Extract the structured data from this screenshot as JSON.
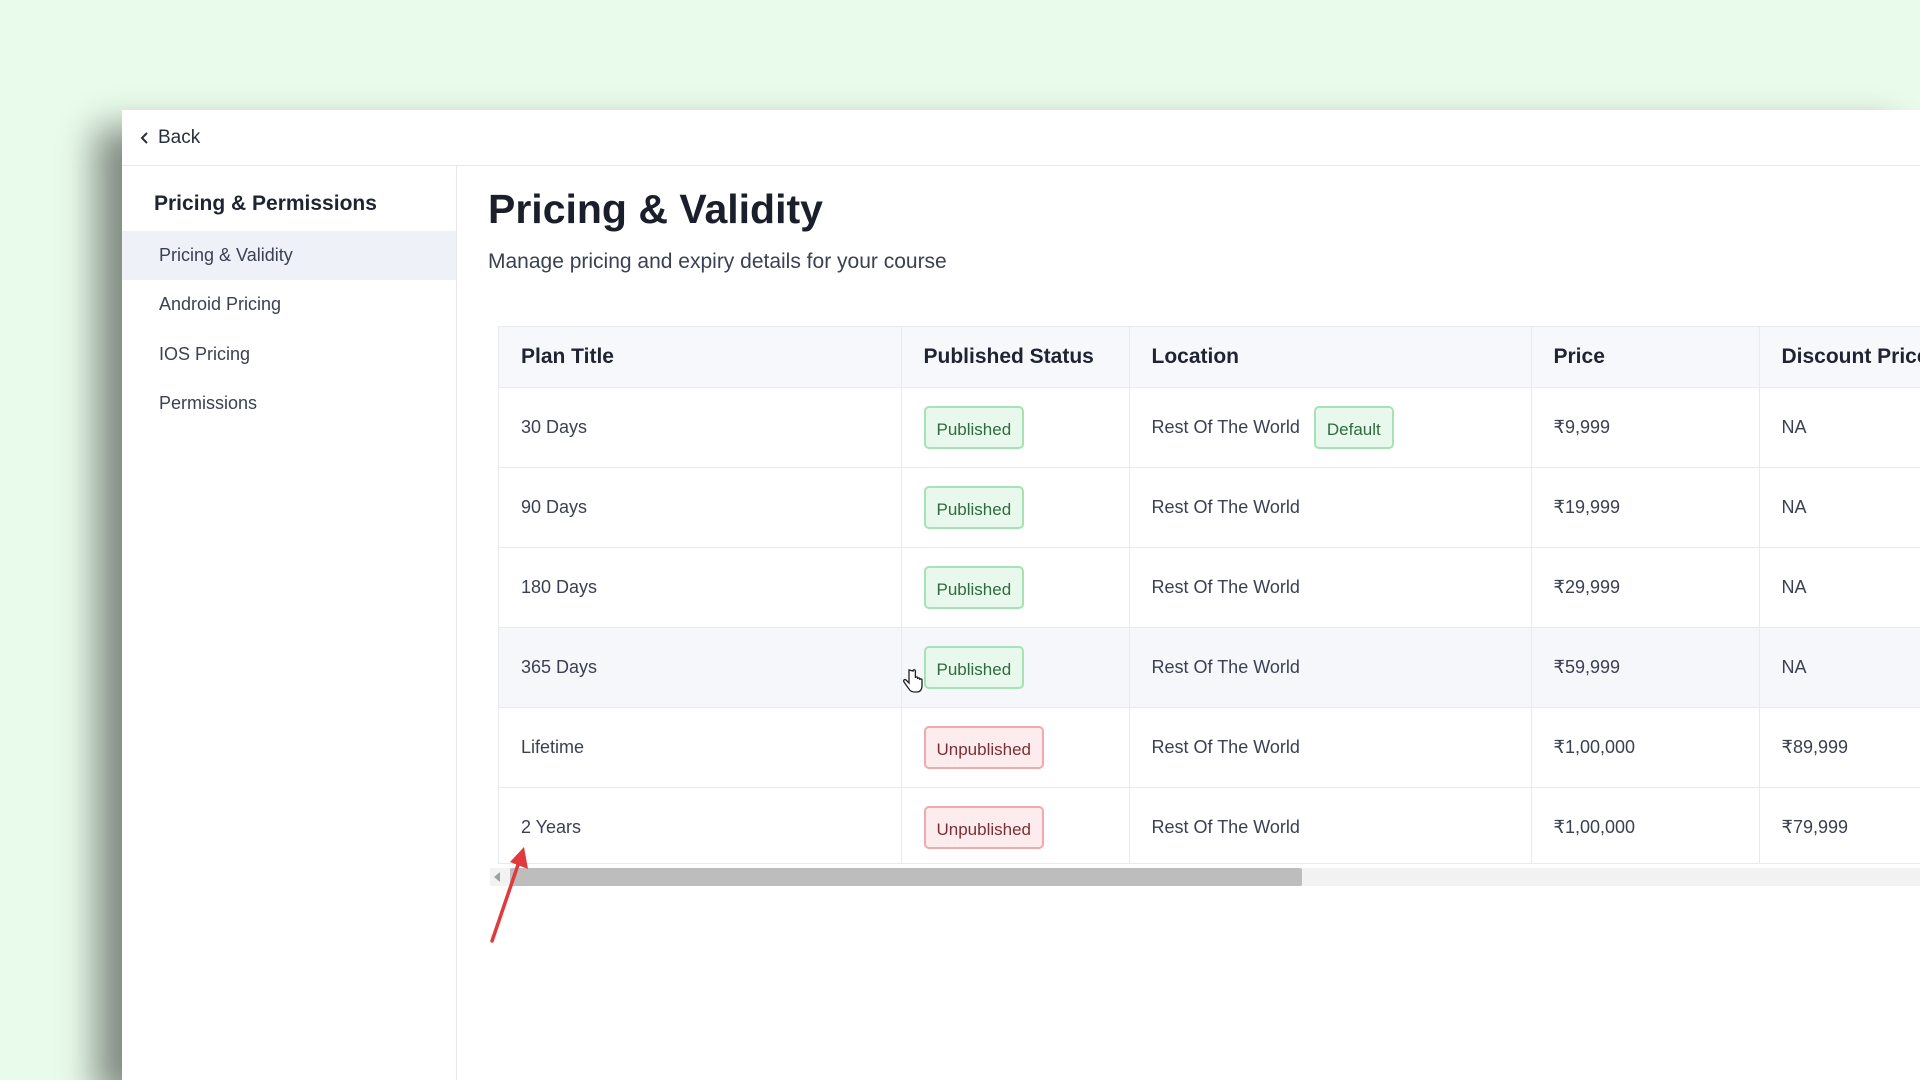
{
  "topbar": {
    "back_label": "Back"
  },
  "sidebar": {
    "title": "Pricing & Permissions",
    "items": [
      {
        "label": "Pricing & Validity",
        "active": true
      },
      {
        "label": "Android Pricing",
        "active": false
      },
      {
        "label": "IOS Pricing",
        "active": false
      },
      {
        "label": "Permissions",
        "active": false
      }
    ]
  },
  "main": {
    "title": "Pricing & Validity",
    "subtitle": "Manage pricing and expiry details for your course"
  },
  "table": {
    "columns": [
      "Plan Title",
      "Published Status",
      "Location",
      "Price",
      "Discount Price"
    ],
    "rows": [
      {
        "plan": "30 Days",
        "status": "Published",
        "location": "Rest Of The World",
        "default": "Default",
        "price": "₹9,999",
        "discount": "NA"
      },
      {
        "plan": "90 Days",
        "status": "Published",
        "location": "Rest Of The World",
        "price": "₹19,999",
        "discount": "NA"
      },
      {
        "plan": "180 Days",
        "status": "Published",
        "location": "Rest Of The World",
        "price": "₹29,999",
        "discount": "NA"
      },
      {
        "plan": "365 Days",
        "status": "Published",
        "location": "Rest Of The World",
        "price": "₹59,999",
        "discount": "NA"
      },
      {
        "plan": "Lifetime",
        "status": "Unpublished",
        "location": "Rest Of The World",
        "price": "₹1,00,000",
        "discount": "₹89,999"
      },
      {
        "plan": "2 Years",
        "status": "Unpublished",
        "location": "Rest Of The World",
        "price": "₹1,00,000",
        "discount": "₹79,999"
      }
    ]
  },
  "colors": {
    "background": "#e9fbea",
    "published_bg": "#e8f8ec",
    "published_border": "#a6e3b4",
    "unpublished_bg": "#fdeced",
    "unpublished_border": "#f1a9ad",
    "annotation_arrow": "#e0393e"
  },
  "icons": [
    "chevron-left-icon",
    "hand-cursor-icon",
    "annotation-arrow-icon"
  ]
}
